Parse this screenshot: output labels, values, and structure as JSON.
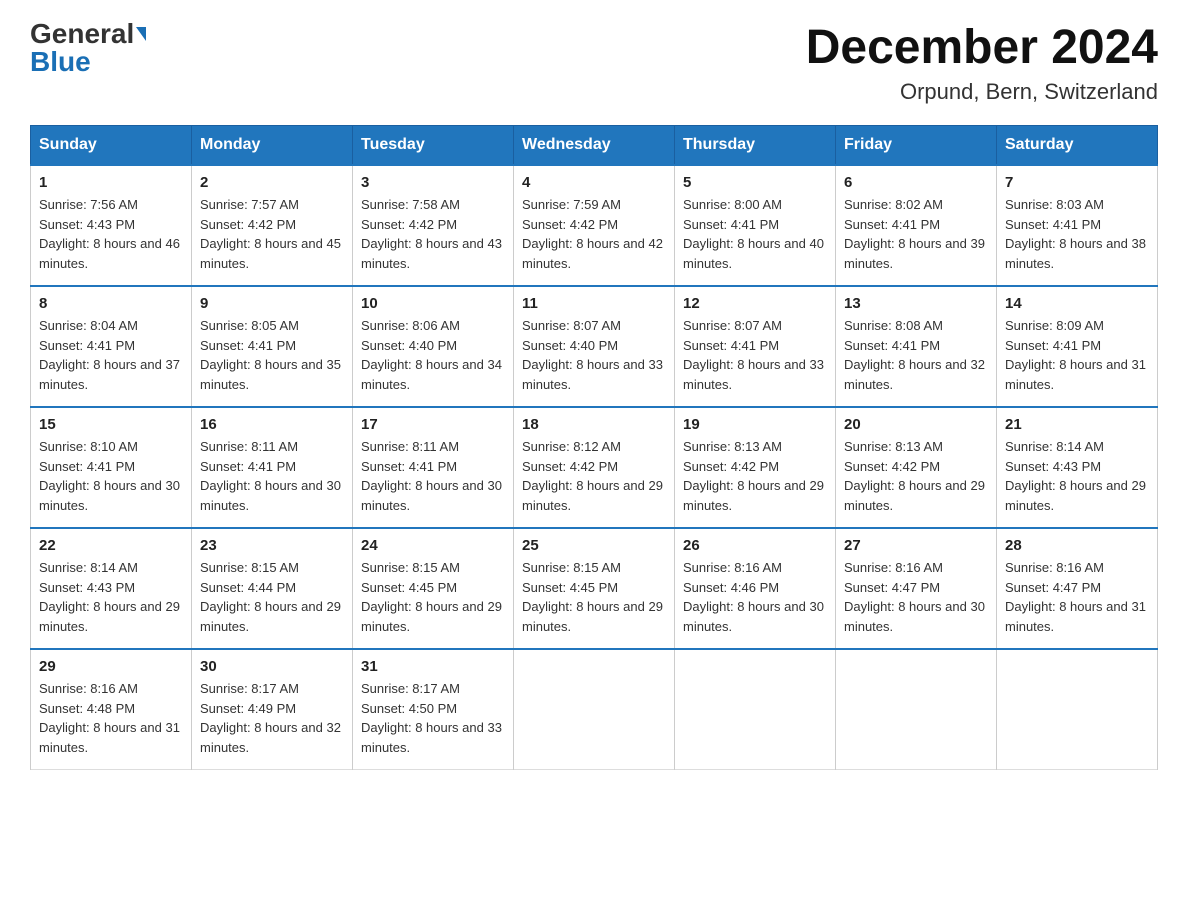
{
  "logo": {
    "general": "General",
    "blue": "Blue"
  },
  "title": "December 2024",
  "location": "Orpund, Bern, Switzerland",
  "headers": [
    "Sunday",
    "Monday",
    "Tuesday",
    "Wednesday",
    "Thursday",
    "Friday",
    "Saturday"
  ],
  "weeks": [
    [
      {
        "day": "1",
        "sunrise": "7:56 AM",
        "sunset": "4:43 PM",
        "daylight": "8 hours and 46 minutes."
      },
      {
        "day": "2",
        "sunrise": "7:57 AM",
        "sunset": "4:42 PM",
        "daylight": "8 hours and 45 minutes."
      },
      {
        "day": "3",
        "sunrise": "7:58 AM",
        "sunset": "4:42 PM",
        "daylight": "8 hours and 43 minutes."
      },
      {
        "day": "4",
        "sunrise": "7:59 AM",
        "sunset": "4:42 PM",
        "daylight": "8 hours and 42 minutes."
      },
      {
        "day": "5",
        "sunrise": "8:00 AM",
        "sunset": "4:41 PM",
        "daylight": "8 hours and 40 minutes."
      },
      {
        "day": "6",
        "sunrise": "8:02 AM",
        "sunset": "4:41 PM",
        "daylight": "8 hours and 39 minutes."
      },
      {
        "day": "7",
        "sunrise": "8:03 AM",
        "sunset": "4:41 PM",
        "daylight": "8 hours and 38 minutes."
      }
    ],
    [
      {
        "day": "8",
        "sunrise": "8:04 AM",
        "sunset": "4:41 PM",
        "daylight": "8 hours and 37 minutes."
      },
      {
        "day": "9",
        "sunrise": "8:05 AM",
        "sunset": "4:41 PM",
        "daylight": "8 hours and 35 minutes."
      },
      {
        "day": "10",
        "sunrise": "8:06 AM",
        "sunset": "4:40 PM",
        "daylight": "8 hours and 34 minutes."
      },
      {
        "day": "11",
        "sunrise": "8:07 AM",
        "sunset": "4:40 PM",
        "daylight": "8 hours and 33 minutes."
      },
      {
        "day": "12",
        "sunrise": "8:07 AM",
        "sunset": "4:41 PM",
        "daylight": "8 hours and 33 minutes."
      },
      {
        "day": "13",
        "sunrise": "8:08 AM",
        "sunset": "4:41 PM",
        "daylight": "8 hours and 32 minutes."
      },
      {
        "day": "14",
        "sunrise": "8:09 AM",
        "sunset": "4:41 PM",
        "daylight": "8 hours and 31 minutes."
      }
    ],
    [
      {
        "day": "15",
        "sunrise": "8:10 AM",
        "sunset": "4:41 PM",
        "daylight": "8 hours and 30 minutes."
      },
      {
        "day": "16",
        "sunrise": "8:11 AM",
        "sunset": "4:41 PM",
        "daylight": "8 hours and 30 minutes."
      },
      {
        "day": "17",
        "sunrise": "8:11 AM",
        "sunset": "4:41 PM",
        "daylight": "8 hours and 30 minutes."
      },
      {
        "day": "18",
        "sunrise": "8:12 AM",
        "sunset": "4:42 PM",
        "daylight": "8 hours and 29 minutes."
      },
      {
        "day": "19",
        "sunrise": "8:13 AM",
        "sunset": "4:42 PM",
        "daylight": "8 hours and 29 minutes."
      },
      {
        "day": "20",
        "sunrise": "8:13 AM",
        "sunset": "4:42 PM",
        "daylight": "8 hours and 29 minutes."
      },
      {
        "day": "21",
        "sunrise": "8:14 AM",
        "sunset": "4:43 PM",
        "daylight": "8 hours and 29 minutes."
      }
    ],
    [
      {
        "day": "22",
        "sunrise": "8:14 AM",
        "sunset": "4:43 PM",
        "daylight": "8 hours and 29 minutes."
      },
      {
        "day": "23",
        "sunrise": "8:15 AM",
        "sunset": "4:44 PM",
        "daylight": "8 hours and 29 minutes."
      },
      {
        "day": "24",
        "sunrise": "8:15 AM",
        "sunset": "4:45 PM",
        "daylight": "8 hours and 29 minutes."
      },
      {
        "day": "25",
        "sunrise": "8:15 AM",
        "sunset": "4:45 PM",
        "daylight": "8 hours and 29 minutes."
      },
      {
        "day": "26",
        "sunrise": "8:16 AM",
        "sunset": "4:46 PM",
        "daylight": "8 hours and 30 minutes."
      },
      {
        "day": "27",
        "sunrise": "8:16 AM",
        "sunset": "4:47 PM",
        "daylight": "8 hours and 30 minutes."
      },
      {
        "day": "28",
        "sunrise": "8:16 AM",
        "sunset": "4:47 PM",
        "daylight": "8 hours and 31 minutes."
      }
    ],
    [
      {
        "day": "29",
        "sunrise": "8:16 AM",
        "sunset": "4:48 PM",
        "daylight": "8 hours and 31 minutes."
      },
      {
        "day": "30",
        "sunrise": "8:17 AM",
        "sunset": "4:49 PM",
        "daylight": "8 hours and 32 minutes."
      },
      {
        "day": "31",
        "sunrise": "8:17 AM",
        "sunset": "4:50 PM",
        "daylight": "8 hours and 33 minutes."
      },
      null,
      null,
      null,
      null
    ]
  ]
}
